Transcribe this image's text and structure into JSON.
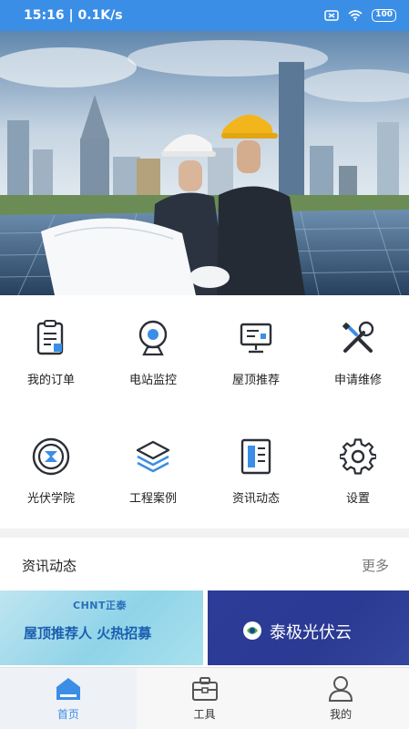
{
  "status_bar": {
    "time": "15:16",
    "speed": "0.1K/s",
    "battery": "100",
    "icons": [
      "sim-off-icon",
      "wifi-icon",
      "battery-icon"
    ]
  },
  "hero": {
    "image": "engineers-with-blueprint-solar-panels-city-skyline"
  },
  "menu": [
    {
      "label": "我的订单",
      "icon": "order-clipboard-icon"
    },
    {
      "label": "电站监控",
      "icon": "monitor-camera-icon"
    },
    {
      "label": "屋顶推荐",
      "icon": "computer-screen-icon"
    },
    {
      "label": "申请维修",
      "icon": "repair-tools-icon"
    },
    {
      "label": "光伏学院",
      "icon": "academy-circle-icon"
    },
    {
      "label": "工程案例",
      "icon": "layers-stack-icon"
    },
    {
      "label": "资讯动态",
      "icon": "news-document-icon"
    },
    {
      "label": "设置",
      "icon": "gear-icon"
    }
  ],
  "news": {
    "title": "资讯动态",
    "more": "更多"
  },
  "banners": {
    "left": {
      "brand": "CHNT正泰",
      "text": "屋顶推荐人  火热招募"
    },
    "right": {
      "text": "泰极光伏云"
    }
  },
  "tabs": [
    {
      "label": "首页",
      "icon": "home-icon",
      "active": true
    },
    {
      "label": "工具",
      "icon": "toolbox-icon",
      "active": false
    },
    {
      "label": "我的",
      "icon": "user-icon",
      "active": false
    }
  ],
  "colors": {
    "primary": "#3a8ee6",
    "icon_dark": "#2b2f36",
    "icon_accent": "#3a8ee6"
  }
}
